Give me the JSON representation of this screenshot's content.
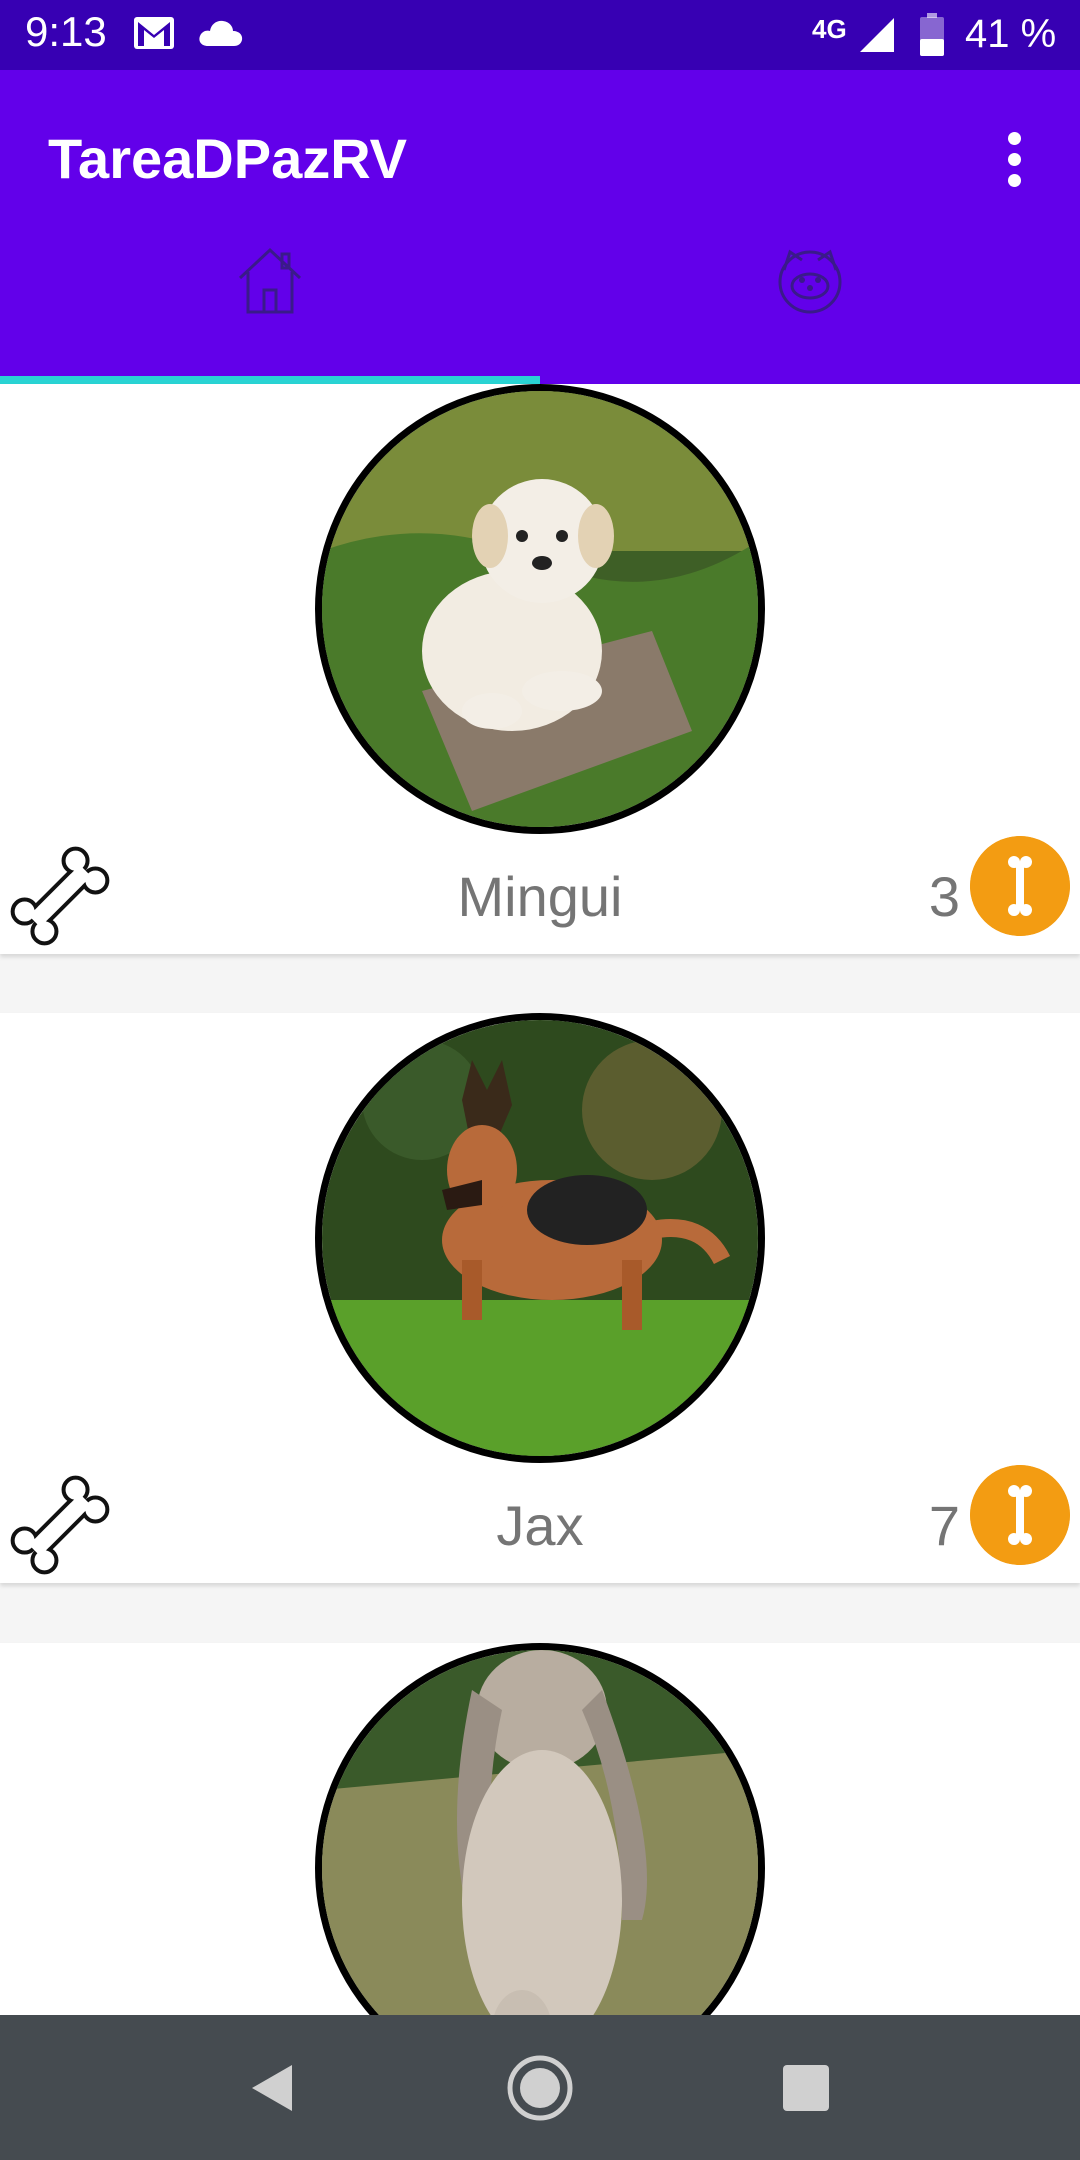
{
  "status_bar": {
    "time": "9:13",
    "network": "4G",
    "battery_percent": "41 %",
    "icons": [
      "gmail-icon",
      "cloud-icon",
      "signal-icon",
      "battery-icon"
    ]
  },
  "app_bar": {
    "title": "TareaDPazRV",
    "menu_icon": "more-vert-icon",
    "tabs": [
      {
        "icon": "home-icon",
        "selected": true
      },
      {
        "icon": "dog-face-icon",
        "selected": false
      }
    ],
    "colors": {
      "primary": "#6200ea",
      "status": "#3700b3",
      "indicator": "#29d3d3"
    }
  },
  "pets": [
    {
      "name": "Mingui",
      "likes": "3",
      "photo": "white-puppy-photo"
    },
    {
      "name": "Jax",
      "likes": "7",
      "photo": "german-shepherd-photo"
    },
    {
      "name": "",
      "likes": "",
      "photo": "rabbit-photo"
    }
  ],
  "colors": {
    "accent": "#f39c12",
    "text_gray": "#757575"
  },
  "nav_bar": {
    "buttons": [
      "back-icon",
      "home-icon",
      "recents-icon"
    ]
  }
}
